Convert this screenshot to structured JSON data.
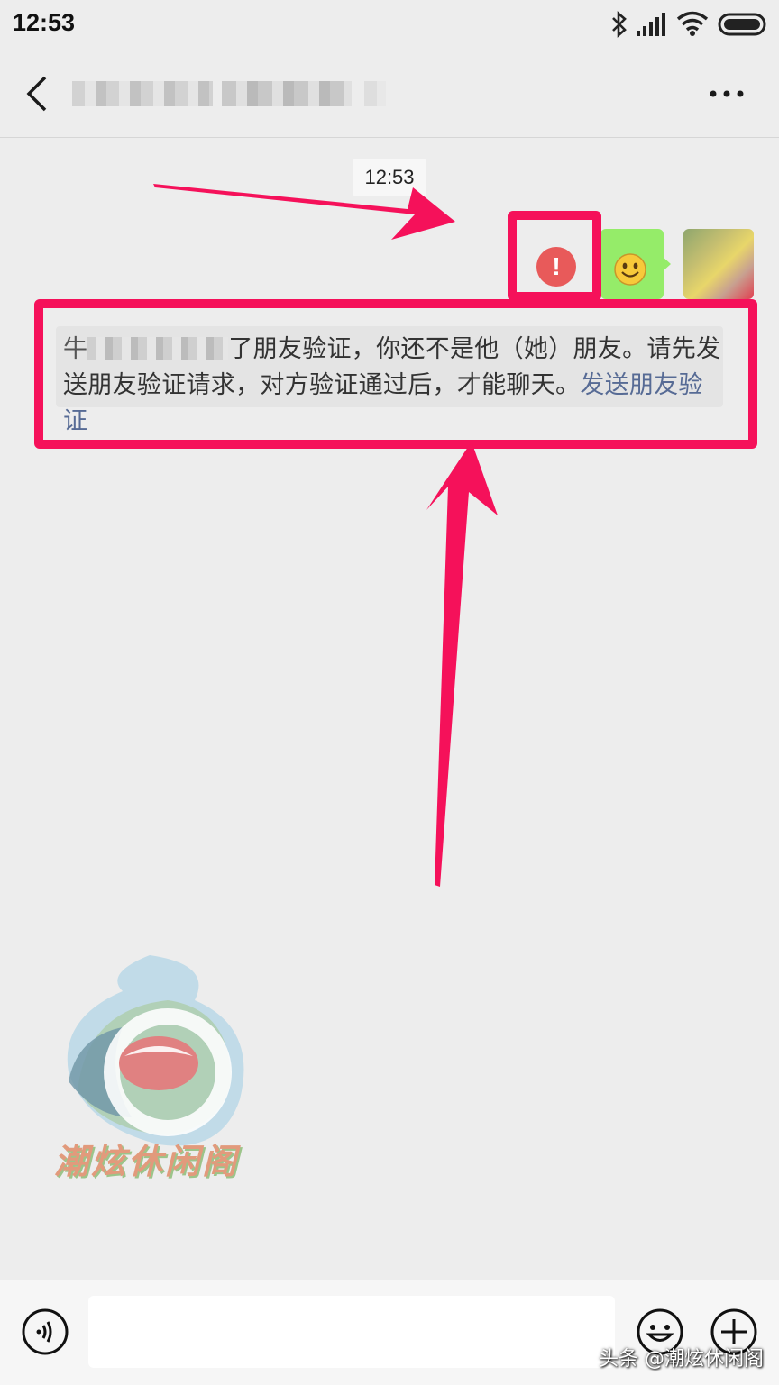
{
  "status_bar": {
    "time": "12:53"
  },
  "header": {
    "title_hidden": true
  },
  "chat": {
    "timestamp": "12:53",
    "message_icon": "smile-emoji",
    "error_icon": "!",
    "notice_text_prefix": "了朋友验证，你还不是他（她）朋友。请先发送朋友验证请求，对方验证通过后，才能聊天。",
    "notice_link": "发送朋友验证"
  },
  "watermark": {
    "text": "潮炫休闲阁"
  },
  "credit": {
    "text": "头条 @潮炫休闲阁"
  },
  "colors": {
    "bubble": "#95ec69",
    "error": "#e85a5a",
    "annotation": "#f5115a",
    "link": "#576b95"
  }
}
